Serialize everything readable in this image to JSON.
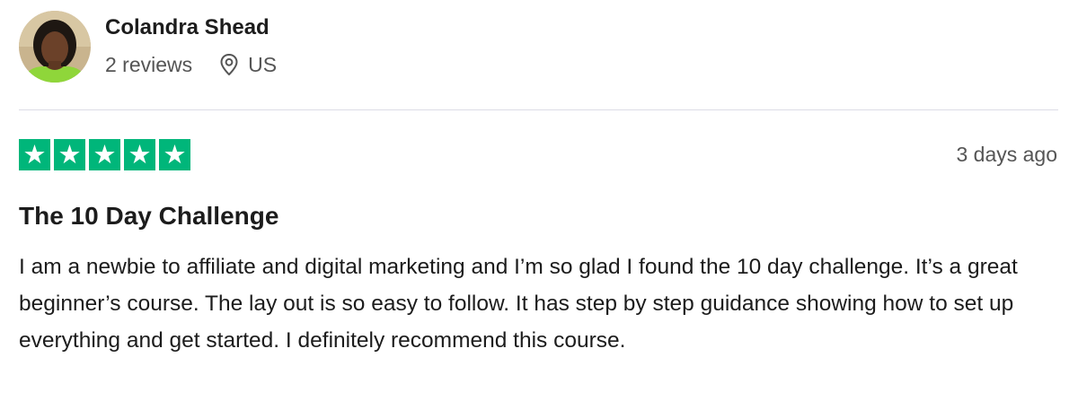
{
  "reviewer": {
    "name": "Colandra Shead",
    "review_count": "2 reviews",
    "location": "US",
    "avatar_icon": "user-photo-avatar"
  },
  "review": {
    "rating": 5,
    "rating_max": 5,
    "star_color": "#00b67a",
    "date": "3 days ago",
    "title": "The 10 Day Challenge",
    "body": "I am a newbie to affiliate and digital marketing and I’m so glad I found the 10 day challenge. It’s a great beginner’s course. The lay out is so easy to follow. It has step by step guidance showing how to set up everything and get started. I definitely recommend this course."
  }
}
